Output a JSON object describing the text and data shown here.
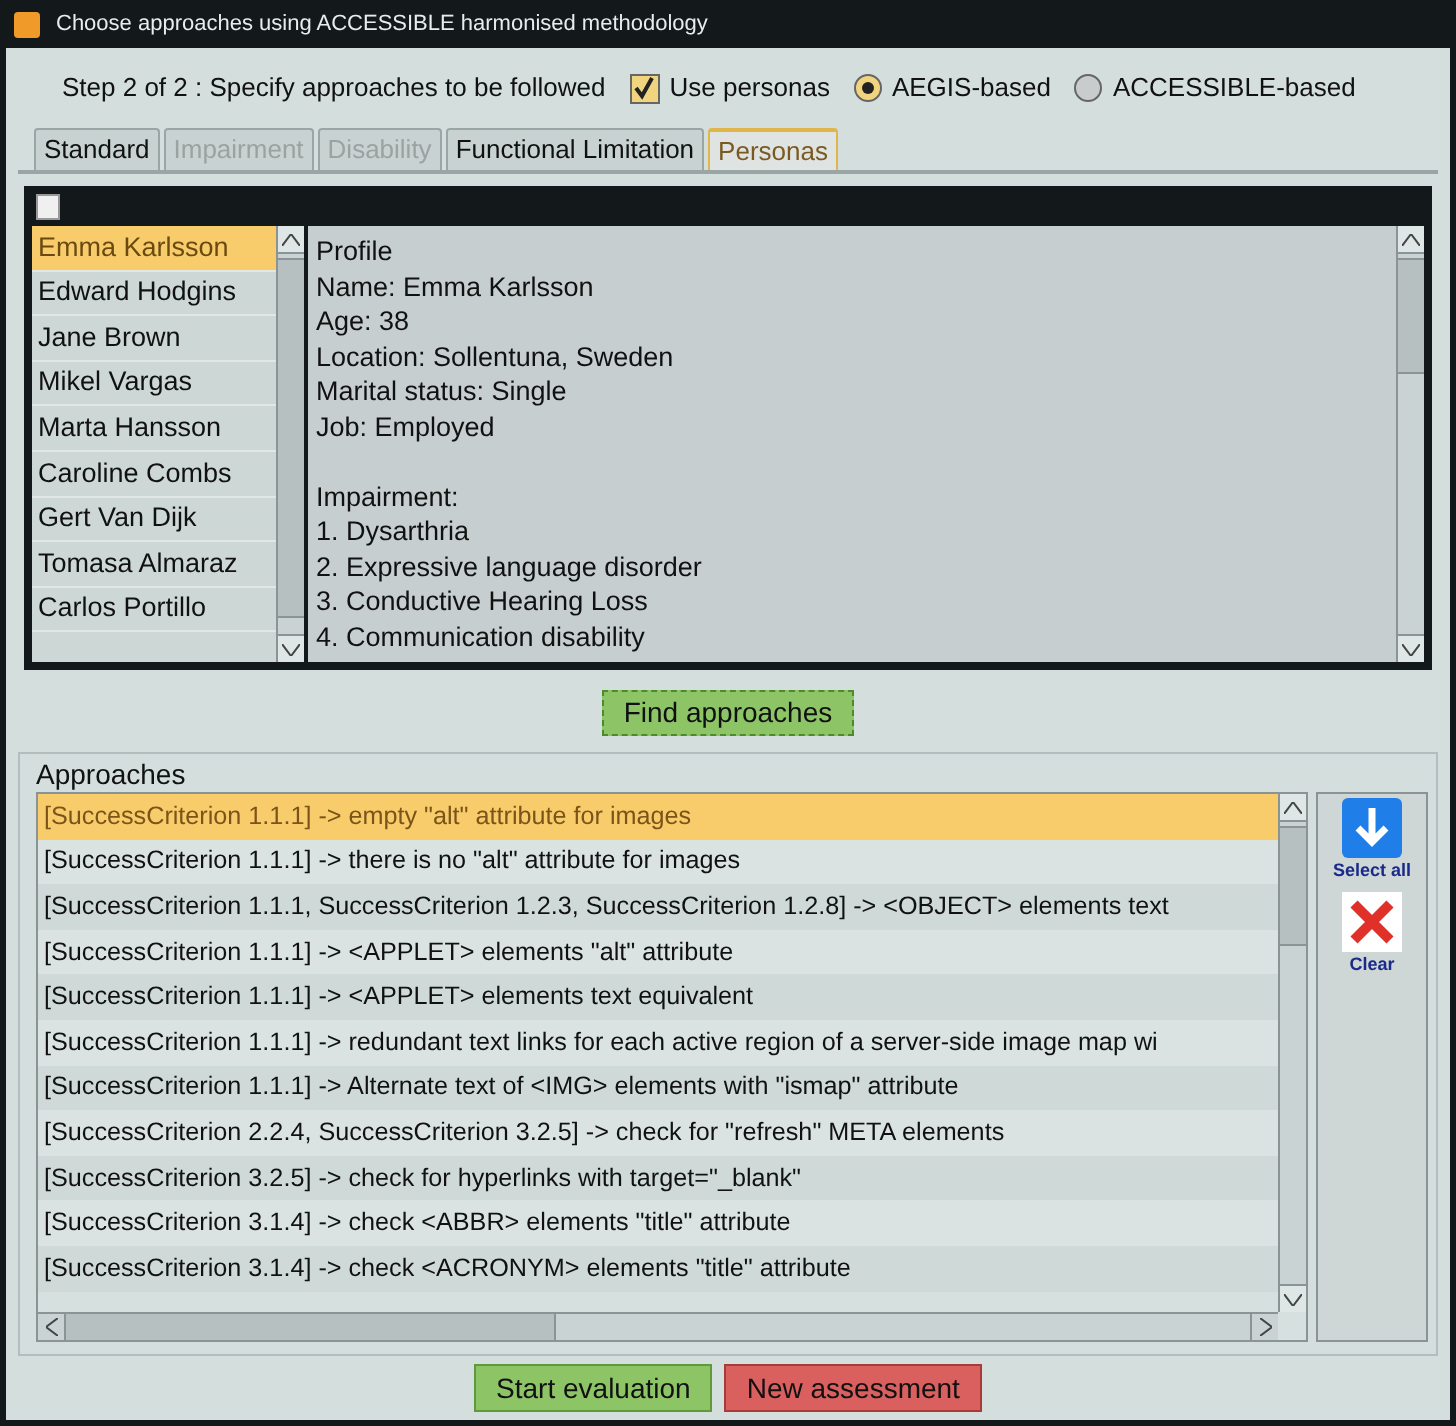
{
  "window": {
    "title": "Choose approaches using ACCESSIBLE harmonised methodology"
  },
  "step": {
    "label": "Step 2 of 2 : Specify approaches to be followed",
    "use_personas": {
      "label": "Use personas",
      "checked": true
    },
    "methods": [
      {
        "label": "AEGIS-based",
        "selected": true
      },
      {
        "label": "ACCESSIBLE-based",
        "selected": false
      }
    ]
  },
  "tabs": [
    {
      "label": "Standard",
      "selected": false,
      "disabled": false
    },
    {
      "label": "Impairment",
      "selected": false,
      "disabled": true
    },
    {
      "label": "Disability",
      "selected": false,
      "disabled": true
    },
    {
      "label": "Functional Limitation",
      "selected": false,
      "disabled": false
    },
    {
      "label": "Personas",
      "selected": true,
      "disabled": false
    }
  ],
  "personas": [
    {
      "name": "Emma Karlsson",
      "selected": true
    },
    {
      "name": "Edward Hodgins",
      "selected": false
    },
    {
      "name": "Jane Brown",
      "selected": false
    },
    {
      "name": "Mikel Vargas",
      "selected": false
    },
    {
      "name": "Marta Hansson",
      "selected": false
    },
    {
      "name": "Caroline Combs",
      "selected": false
    },
    {
      "name": "Gert Van Dijk",
      "selected": false
    },
    {
      "name": "Tomasa Almaraz",
      "selected": false
    },
    {
      "name": "Carlos Portillo",
      "selected": false
    }
  ],
  "profile": [
    [
      "Profile",
      "Name: Emma Karlsson",
      "Age: 38",
      "Location: Sollentuna, Sweden",
      "Marital status: Single",
      "Job: Employed"
    ],
    [
      "Impairment:",
      "1. Dysarthria",
      "2. Expressive language disorder",
      "3. Conductive Hearing Loss",
      "4. Communication disability"
    ]
  ],
  "find_button": "Find approaches",
  "approaches": {
    "title": "Approaches",
    "items": [
      {
        "text": "[SuccessCriterion 1.1.1] -> empty \"alt\" attribute for images",
        "selected": true
      },
      {
        "text": "[SuccessCriterion 1.1.1] -> there is no \"alt\" attribute for images",
        "selected": false
      },
      {
        "text": "[SuccessCriterion 1.1.1, SuccessCriterion 1.2.3, SuccessCriterion 1.2.8] -> <OBJECT> elements text",
        "selected": false
      },
      {
        "text": "[SuccessCriterion 1.1.1] -> <APPLET> elements \"alt\" attribute",
        "selected": false
      },
      {
        "text": "[SuccessCriterion 1.1.1] -> <APPLET> elements text equivalent",
        "selected": false
      },
      {
        "text": "[SuccessCriterion 1.1.1] -> redundant text links for each active region of a server-side image map wi",
        "selected": false
      },
      {
        "text": "[SuccessCriterion 1.1.1] -> Alternate text of <IMG> elements with \"ismap\" attribute",
        "selected": false
      },
      {
        "text": "[SuccessCriterion 2.2.4, SuccessCriterion 3.2.5] -> check for \"refresh\" META elements",
        "selected": false
      },
      {
        "text": "[SuccessCriterion 3.2.5] -> check for hyperlinks with target=\"_blank\"",
        "selected": false
      },
      {
        "text": "[SuccessCriterion 3.1.4] -> check <ABBR> elements \"title\" attribute",
        "selected": false
      },
      {
        "text": "[SuccessCriterion 3.1.4] -> check <ACRONYM> elements \"title\" attribute",
        "selected": false
      }
    ],
    "select_all": "Select all",
    "clear": "Clear"
  },
  "buttons": [
    {
      "label": "Start evaluation",
      "kind": "start"
    },
    {
      "label": "New assessment",
      "kind": "reset"
    }
  ]
}
